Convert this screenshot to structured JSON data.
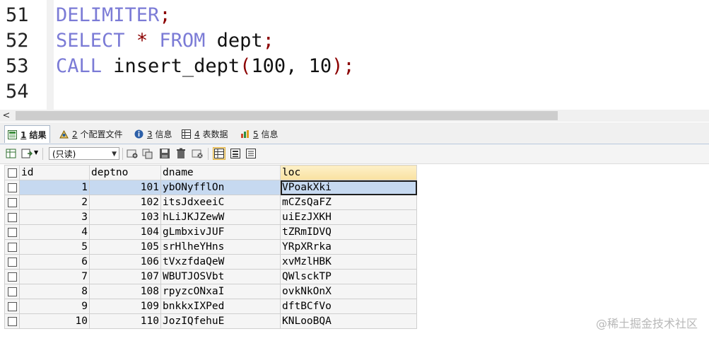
{
  "editor": {
    "lines": [
      {
        "num": "51",
        "tokens": [
          {
            "t": "DELIMITER",
            "c": "kw"
          },
          {
            "t": ";",
            "c": "pu"
          }
        ]
      },
      {
        "num": "52",
        "tokens": [
          {
            "t": "SELECT",
            "c": "kw"
          },
          {
            "t": " ",
            "c": "pl"
          },
          {
            "t": "*",
            "c": "op"
          },
          {
            "t": " ",
            "c": "pl"
          },
          {
            "t": "FROM",
            "c": "kw"
          },
          {
            "t": " dept",
            "c": "pl"
          },
          {
            "t": ";",
            "c": "pu"
          }
        ]
      },
      {
        "num": "53",
        "tokens": [
          {
            "t": "CALL",
            "c": "kw"
          },
          {
            "t": " insert_dept",
            "c": "pl"
          },
          {
            "t": "(",
            "c": "pu"
          },
          {
            "t": "100, 10",
            "c": "pl"
          },
          {
            "t": ");",
            "c": "pu"
          }
        ]
      },
      {
        "num": "54",
        "tokens": []
      }
    ]
  },
  "scrollbar": {
    "left_arrow": "<"
  },
  "tabs": [
    {
      "num": "1",
      "label": "结果",
      "active": true,
      "icon": "results-grid-icon"
    },
    {
      "num": "2",
      "label": "个配置文件",
      "active": false,
      "icon": "profile-icon"
    },
    {
      "num": "3",
      "label": "信息",
      "active": false,
      "icon": "info-icon"
    },
    {
      "num": "4",
      "label": "表数据",
      "active": false,
      "icon": "table-data-icon"
    },
    {
      "num": "5",
      "label": "信息",
      "active": false,
      "icon": "info-chart-icon"
    }
  ],
  "toolbar": {
    "readonly_value": "(只读)",
    "icons": [
      "export-grid-icon",
      "import-icon",
      "add-row-icon",
      "duplicate-row-icon",
      "save-icon",
      "delete-icon",
      "discard-icon",
      "grid-view-icon",
      "form-view-icon",
      "text-view-icon"
    ]
  },
  "grid": {
    "columns": [
      "id",
      "deptno",
      "dname",
      "loc"
    ],
    "sorted_column": "loc",
    "rows": [
      [
        "1",
        "101",
        "ybONyfflOn",
        "VPoakXki"
      ],
      [
        "2",
        "102",
        "itsJdxeeiC",
        "mCZsQaFZ"
      ],
      [
        "3",
        "103",
        "hLiJKJZewW",
        "uiEzJXKH"
      ],
      [
        "4",
        "104",
        "gLmbxivJUF",
        "tZRmIDVQ"
      ],
      [
        "5",
        "105",
        "srHlheYHns",
        "YRpXRrka"
      ],
      [
        "6",
        "106",
        "tVxzfdaQeW",
        "xvMzlHBK"
      ],
      [
        "7",
        "107",
        "WBUTJOSVbt",
        "QWlsckTP"
      ],
      [
        "8",
        "108",
        "rpyzcONxaI",
        "ovkNkOnX"
      ],
      [
        "9",
        "109",
        "bnkkxIXPed",
        "dftBCfVo"
      ],
      [
        "10",
        "110",
        "JozIQfehuE",
        "KNLooBQA"
      ]
    ],
    "selected_row": 0
  },
  "watermark": "@稀土掘金技术社区"
}
